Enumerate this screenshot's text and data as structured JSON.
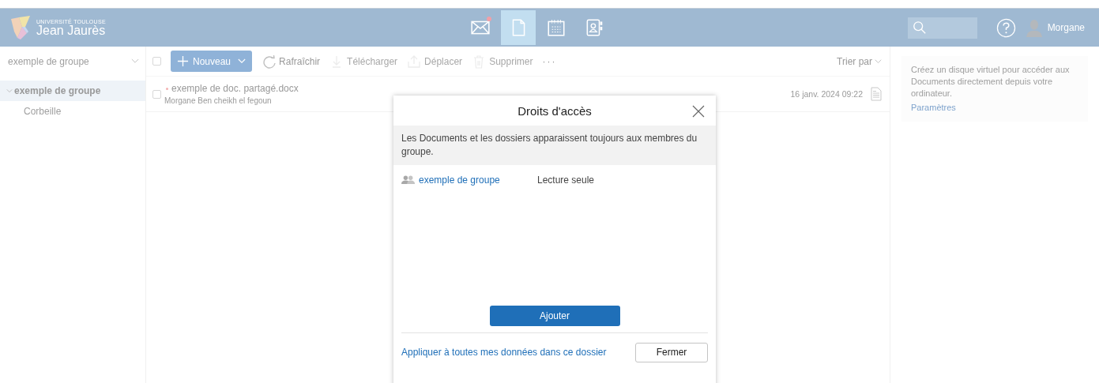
{
  "header": {
    "logo": {
      "line1": "UNIVERSITÉ TOULOUSE",
      "line2": "Jean Jaurès"
    },
    "nav": [
      {
        "kind": "mail",
        "selected": false,
        "notification": true
      },
      {
        "kind": "documents",
        "selected": true,
        "notification": false
      },
      {
        "kind": "calendar",
        "selected": false,
        "notification": false
      },
      {
        "kind": "contacts",
        "selected": false,
        "notification": false
      }
    ],
    "user": {
      "name": "Morgane"
    }
  },
  "sidebar": {
    "group_select": "exemple de groupe",
    "tree": [
      {
        "label": "exemple de groupe",
        "expanded": true,
        "selected": true,
        "children": [
          {
            "label": "Corbeille",
            "selected": false
          }
        ]
      }
    ]
  },
  "toolbar": {
    "select_all": {
      "checked": false
    },
    "actions": [
      {
        "kind": "new",
        "label": "Nouveau",
        "disabled": false
      },
      {
        "kind": "refresh",
        "label": "Rafraîchir",
        "disabled": false
      },
      {
        "kind": "download",
        "label": "Télécharger",
        "disabled": true
      },
      {
        "kind": "move",
        "label": "Déplacer",
        "disabled": true
      },
      {
        "kind": "delete",
        "label": "Supprimer",
        "disabled": true
      },
      {
        "kind": "more",
        "label": "···",
        "disabled": false
      }
    ],
    "sort_label": "Trier par"
  },
  "files": [
    {
      "name": "exemple de doc. partagé.docx",
      "author": "Morgane Ben cheikh el fegoun",
      "date": "16 janv. 2024 09:22",
      "checked": false,
      "new": true
    }
  ],
  "info_panel": {
    "message": "Créez un disque virtuel pour accéder aux Documents directement depuis votre ordinateur.",
    "link": "Paramètres"
  },
  "dialog": {
    "title": "Droits d'accès",
    "notice": "Les Documents et les dossiers apparaissent toujours aux membres du groupe.",
    "entries": [
      {
        "name": "exemple de groupe",
        "permission": "Lecture seule"
      }
    ],
    "add_button": "Ajouter",
    "apply_link": "Appliquer à toutes mes données dans ce dossier",
    "close_button": "Fermer"
  }
}
